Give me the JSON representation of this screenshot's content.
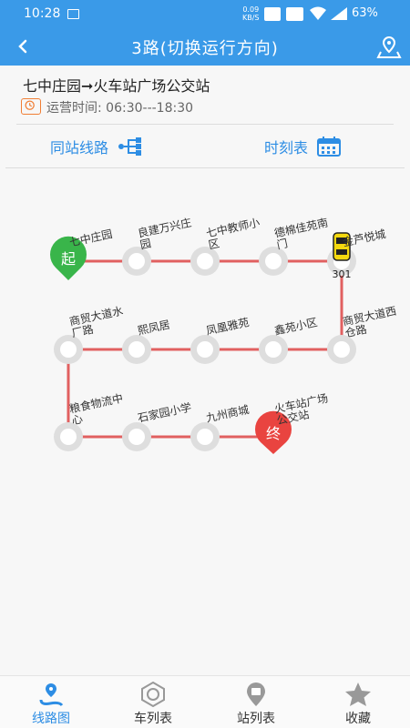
{
  "status": {
    "time": "10:28",
    "speed_value": "0.09",
    "speed_unit": "KB/S",
    "battery": "63%"
  },
  "header": {
    "title": "3路(切换运行方向)"
  },
  "route": {
    "direction": "七中庄园➞火车站广场公交站",
    "op_time": "运营时间: 06:30---18:30"
  },
  "tabs": {
    "same_station": "同站线路",
    "timetable": "时刻表"
  },
  "stations": [
    "七中庄园",
    "良建万兴庄\n园",
    "七中教师小\n区",
    "德棉佳苑南\n门",
    "金芦悦城",
    "商贸大道西\n仓路",
    "鑫苑小区",
    "凤凰雅苑",
    "熙凤居",
    "商贸大道水\n厂路",
    "粮食物流中\n心",
    "石家园小学",
    "九州商城",
    "火车站广场\n公交站"
  ],
  "markers": {
    "start": "起",
    "end": "终"
  },
  "bus": {
    "plate": "301"
  },
  "nav": [
    {
      "label": "线路图",
      "icon": "route-map-icon",
      "active": true
    },
    {
      "label": "车列表",
      "icon": "bus-list-icon",
      "active": false
    },
    {
      "label": "站列表",
      "icon": "station-list-icon",
      "active": false
    },
    {
      "label": "收藏",
      "icon": "star-icon",
      "active": false
    }
  ],
  "colors": {
    "primary": "#3a9ae8",
    "link": "#2d8de4",
    "start": "#39b54a",
    "end": "#e94440",
    "line": "#e16060",
    "bus": "#f5d90f",
    "clock": "#f07e35"
  }
}
